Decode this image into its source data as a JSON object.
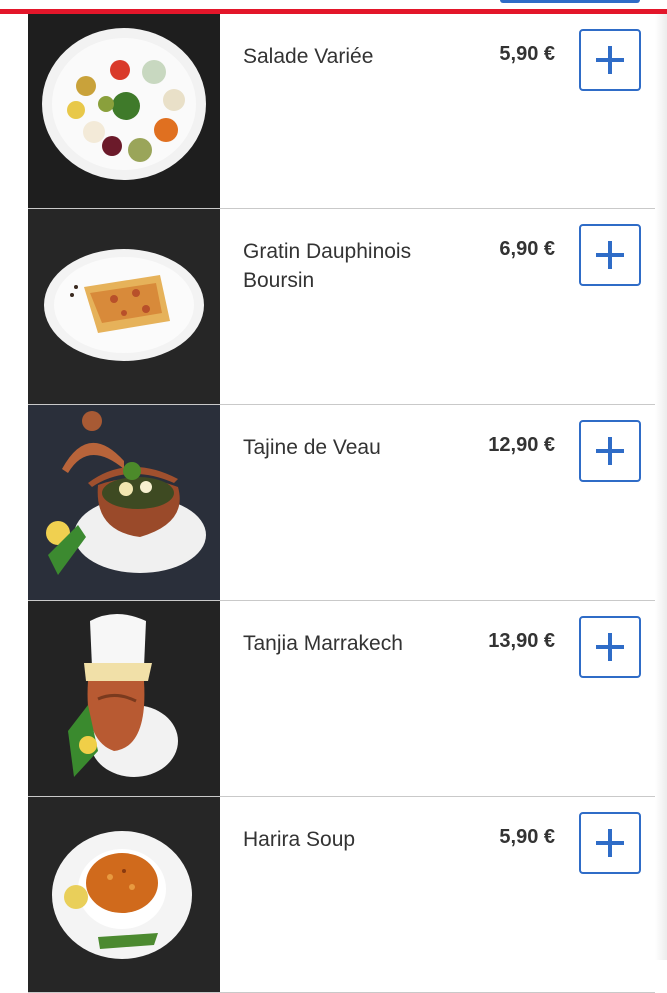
{
  "colors": {
    "accent": "#2f6cc7",
    "header_red": "#e3162a",
    "text": "#333333",
    "divider": "#c9c9c9"
  },
  "menu": {
    "items": [
      {
        "name": "Salade Variée",
        "price": "5,90 €",
        "add_icon": "plus-icon"
      },
      {
        "name": "Gratin Dauphinois Boursin",
        "price": "6,90 €",
        "add_icon": "plus-icon"
      },
      {
        "name": "Tajine de Veau",
        "price": "12,90 €",
        "add_icon": "plus-icon"
      },
      {
        "name": "Tanjia Marrakech",
        "price": "13,90 €",
        "add_icon": "plus-icon"
      },
      {
        "name": "Harira Soup",
        "price": "5,90 €",
        "add_icon": "plus-icon"
      }
    ]
  }
}
